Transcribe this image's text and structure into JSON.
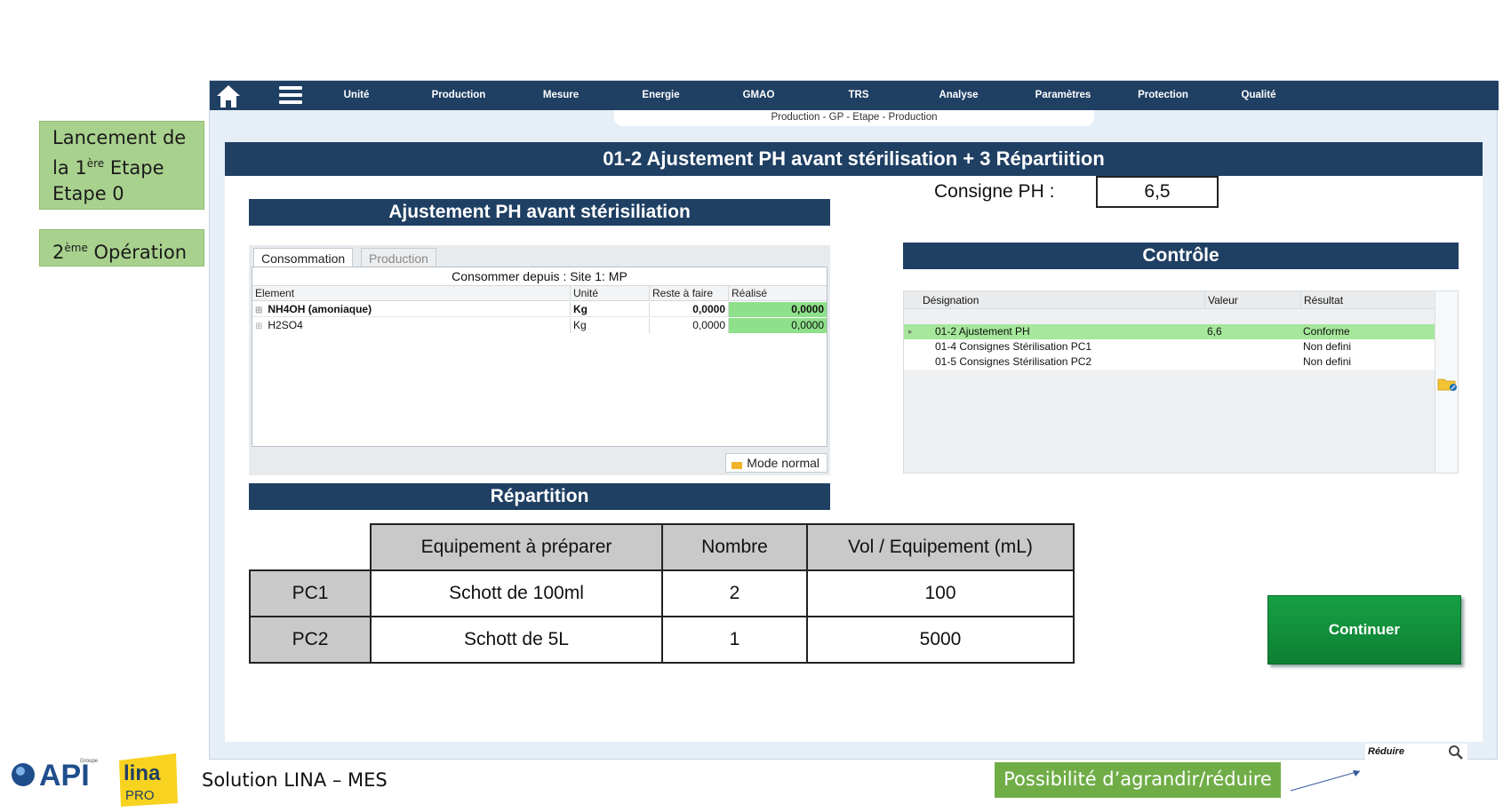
{
  "annotations": {
    "launch_line1": "Lancement de",
    "launch_line2_pre": "la 1",
    "launch_line2_sup": "ère",
    "launch_line2_post": " Etape",
    "launch_line3": "Etape 0",
    "operation_sup": "ème",
    "operation_num": "2",
    "operation_text": " Opération",
    "resize_note": "Possibilité d’agrandir/réduire"
  },
  "nav": {
    "items": [
      "Unité",
      "Production",
      "Mesure",
      "Energie",
      "GMAO",
      "TRS",
      "Analyse",
      "Paramètres",
      "Protection",
      "Qualité"
    ],
    "breadcrumb": "Production - GP - Etape - Production"
  },
  "page": {
    "title": "01-2 Ajustement PH avant stérilisation + 3 Répartiition"
  },
  "ajustement": {
    "heading": "Ajustement PH avant stérisiliation",
    "tabs": [
      "Consommation",
      "Production"
    ],
    "caption": "Consommer depuis : Site 1: MP",
    "columns": [
      "Element",
      "Unité",
      "Reste à faire",
      "Réalisé"
    ],
    "rows": [
      {
        "element": "NH4OH (amoniaque)",
        "unite": "Kg",
        "reste": "0,0000",
        "realise": "0,0000"
      },
      {
        "element": "H2SO4",
        "unite": "Kg",
        "reste": "0,0000",
        "realise": "0,0000"
      }
    ],
    "mode_button": "Mode normal"
  },
  "consigne": {
    "label": "Consigne PH :",
    "value": "6,5"
  },
  "controle": {
    "heading": "Contrôle",
    "columns": [
      "Désignation",
      "Valeur",
      "Résultat"
    ],
    "rows": [
      {
        "designation": "01-2 Ajustement PH",
        "valeur": "6,6",
        "resultat": "Conforme"
      },
      {
        "designation": "01-4 Consignes Stérilisation PC1",
        "valeur": "",
        "resultat": "Non defini"
      },
      {
        "designation": "01-5 Consignes Stérilisation PC2",
        "valeur": "",
        "resultat": "Non defini"
      }
    ]
  },
  "repartition": {
    "heading": "Répartition",
    "columns": [
      "Equipement à préparer",
      "Nombre",
      "Vol / Equipement (mL)"
    ],
    "rows": [
      {
        "label": "PC1",
        "equipement": "Schott de 100ml",
        "nombre": "2",
        "vol": "100"
      },
      {
        "label": "PC2",
        "equipement": "Schott de 5L",
        "nombre": "1",
        "vol": "5000"
      }
    ]
  },
  "actions": {
    "continue": "Continuer",
    "reduce": "Réduire"
  },
  "footer": {
    "title": "Solution LINA – MES",
    "logo_api": "API",
    "logo_api_group": "Groupe",
    "logo_lina": "lina",
    "logo_pro": "PRO"
  },
  "colors": {
    "nav_bg": "#1f3f63",
    "note_green": "#a9d18e",
    "note_dark_green": "#70ad47",
    "conforme_green": "#8ee08a",
    "continue_green": "#12903b"
  }
}
